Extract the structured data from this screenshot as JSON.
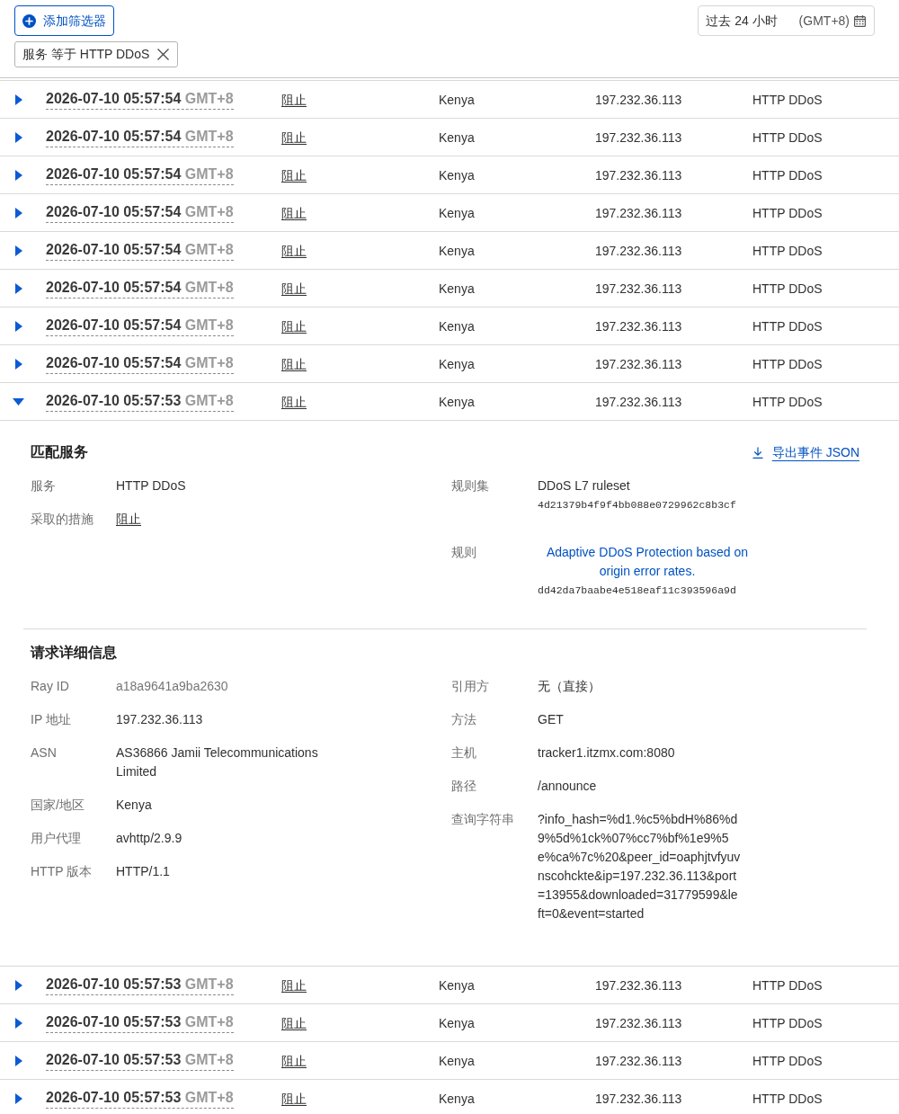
{
  "toolbar": {
    "add_filter": "添加筛选器",
    "time_range": {
      "label": "过去 24 小时",
      "timezone": "(GMT+8)"
    }
  },
  "filters": [
    {
      "text": "服务 等于 HTTP DDoS"
    }
  ],
  "events": [
    {
      "timestamp": "2026-07-10 05:57:54",
      "timezone": "GMT+8",
      "action": "阻止",
      "country": "Kenya",
      "ip": "197.232.36.113",
      "service": "HTTP DDoS",
      "expanded": false
    },
    {
      "timestamp": "2026-07-10 05:57:54",
      "timezone": "GMT+8",
      "action": "阻止",
      "country": "Kenya",
      "ip": "197.232.36.113",
      "service": "HTTP DDoS",
      "expanded": false
    },
    {
      "timestamp": "2026-07-10 05:57:54",
      "timezone": "GMT+8",
      "action": "阻止",
      "country": "Kenya",
      "ip": "197.232.36.113",
      "service": "HTTP DDoS",
      "expanded": false
    },
    {
      "timestamp": "2026-07-10 05:57:54",
      "timezone": "GMT+8",
      "action": "阻止",
      "country": "Kenya",
      "ip": "197.232.36.113",
      "service": "HTTP DDoS",
      "expanded": false
    },
    {
      "timestamp": "2026-07-10 05:57:54",
      "timezone": "GMT+8",
      "action": "阻止",
      "country": "Kenya",
      "ip": "197.232.36.113",
      "service": "HTTP DDoS",
      "expanded": false
    },
    {
      "timestamp": "2026-07-10 05:57:54",
      "timezone": "GMT+8",
      "action": "阻止",
      "country": "Kenya",
      "ip": "197.232.36.113",
      "service": "HTTP DDoS",
      "expanded": false
    },
    {
      "timestamp": "2026-07-10 05:57:54",
      "timezone": "GMT+8",
      "action": "阻止",
      "country": "Kenya",
      "ip": "197.232.36.113",
      "service": "HTTP DDoS",
      "expanded": false
    },
    {
      "timestamp": "2026-07-10 05:57:54",
      "timezone": "GMT+8",
      "action": "阻止",
      "country": "Kenya",
      "ip": "197.232.36.113",
      "service": "HTTP DDoS",
      "expanded": false
    },
    {
      "timestamp": "2026-07-10 05:57:53",
      "timezone": "GMT+8",
      "action": "阻止",
      "country": "Kenya",
      "ip": "197.232.36.113",
      "service": "HTTP DDoS",
      "expanded": true,
      "details": {
        "sections": [
          {
            "title": "匹配服务",
            "export_link": "导出事件 JSON",
            "left": [
              {
                "label": "服务",
                "value": "HTTP DDoS",
                "kind": "text"
              },
              {
                "label": "采取的措施",
                "value": "阻止",
                "kind": "action"
              }
            ],
            "right": [
              {
                "label": "规则集",
                "value": "DDoS L7 ruleset",
                "kind": "text",
                "hash": "4d21379b4f9f4bb088e0729962c8b3cf"
              },
              {
                "label": "规则",
                "value": "Adaptive DDoS Protection based on origin error rates.",
                "kind": "link",
                "hash": "dd42da7baabe4e518eaf11c393596a9d"
              }
            ]
          },
          {
            "title": "请求详细信息",
            "left": [
              {
                "label": "Ray ID",
                "value": "a18a9641a9ba2630",
                "kind": "muted"
              },
              {
                "label": "IP 地址",
                "value": "197.232.36.113",
                "kind": "text"
              },
              {
                "label": "ASN",
                "value": "AS36866 Jamii Telecommunications Limited",
                "kind": "text"
              },
              {
                "label": "国家/地区",
                "value": "Kenya",
                "kind": "text"
              },
              {
                "label": "用户代理",
                "value": "avhttp/2.9.9",
                "kind": "text"
              },
              {
                "label": "HTTP 版本",
                "value": "HTTP/1.1",
                "kind": "text"
              }
            ],
            "right": [
              {
                "label": "引用方",
                "value": "无（直接）",
                "kind": "text"
              },
              {
                "label": "方法",
                "value": "GET",
                "kind": "text"
              },
              {
                "label": "主机",
                "value": "tracker1.itzmx.com:8080",
                "kind": "text"
              },
              {
                "label": "路径",
                "value": "/announce",
                "kind": "text"
              },
              {
                "label": "查询字符串",
                "value": "?info_hash=%d1.%c5%bdH%86%d9%5d%1ck%07%cc7%bf%1e9%5e%ca%7c%20&peer_id=oaphjtvfyuvnscohckte&ip=197.232.36.113&port=13955&downloaded=31779599&left=0&event=started",
                "kind": "query"
              }
            ]
          }
        ]
      }
    },
    {
      "timestamp": "2026-07-10 05:57:53",
      "timezone": "GMT+8",
      "action": "阻止",
      "country": "Kenya",
      "ip": "197.232.36.113",
      "service": "HTTP DDoS",
      "expanded": false
    },
    {
      "timestamp": "2026-07-10 05:57:53",
      "timezone": "GMT+8",
      "action": "阻止",
      "country": "Kenya",
      "ip": "197.232.36.113",
      "service": "HTTP DDoS",
      "expanded": false
    },
    {
      "timestamp": "2026-07-10 05:57:53",
      "timezone": "GMT+8",
      "action": "阻止",
      "country": "Kenya",
      "ip": "197.232.36.113",
      "service": "HTTP DDoS",
      "expanded": false
    },
    {
      "timestamp": "2026-07-10 05:57:53",
      "timezone": "GMT+8",
      "action": "阻止",
      "country": "Kenya",
      "ip": "197.232.36.113",
      "service": "HTTP DDoS",
      "expanded": false
    }
  ]
}
